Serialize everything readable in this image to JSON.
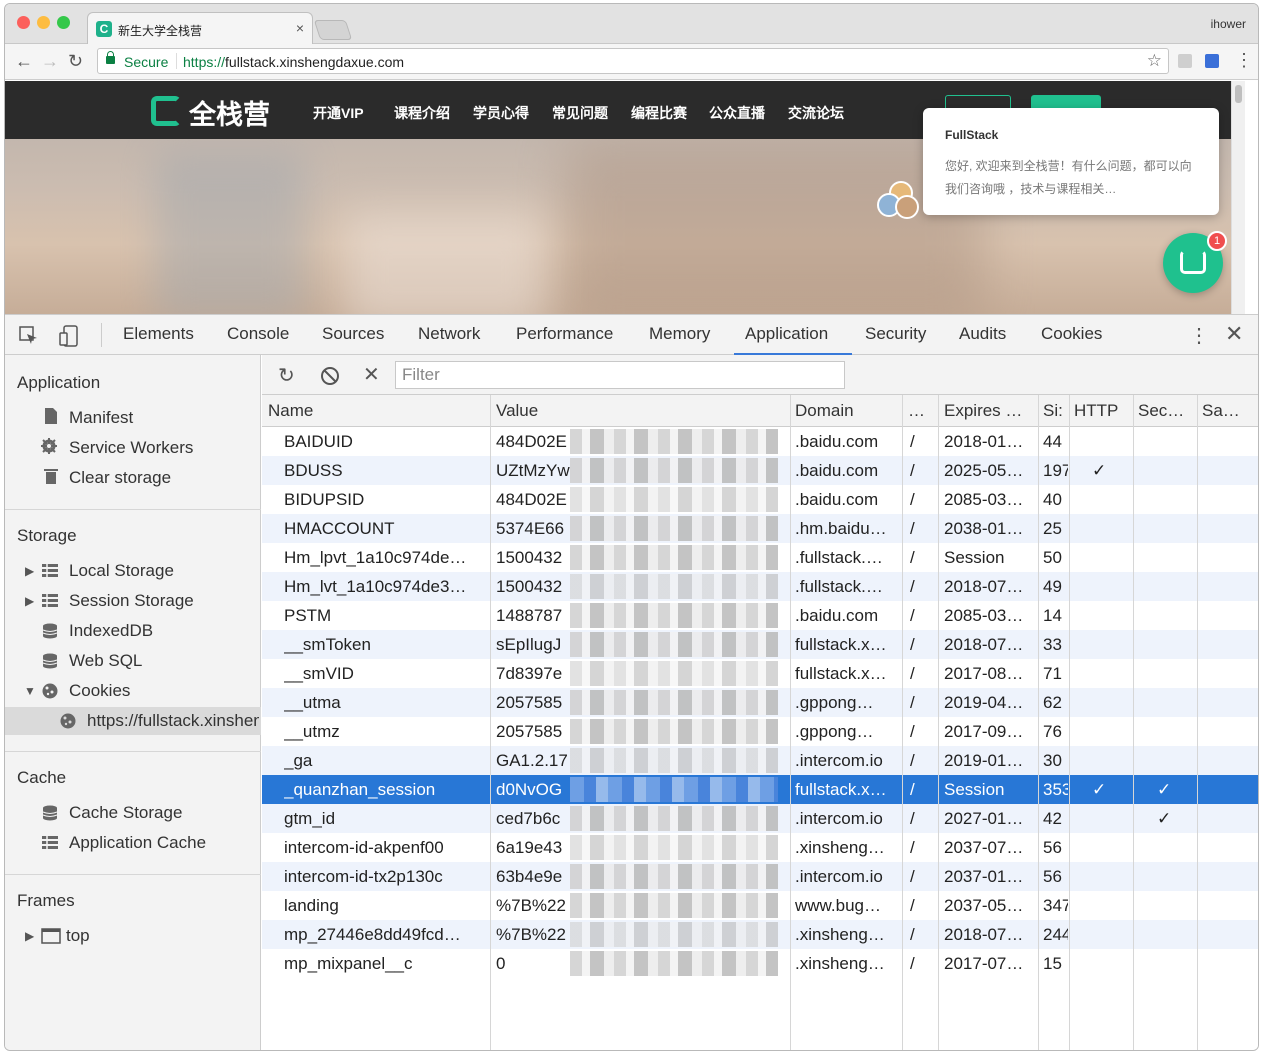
{
  "browser": {
    "tab_title": "新生大学全栈营",
    "tab_close": "×",
    "user_name": "ihower",
    "secure_label": "Secure",
    "url_scheme": "https://",
    "url_host": "fullstack.xinshengdaxue.com",
    "colors": {
      "secure": "#0b8043",
      "close": "#fc605c",
      "minimize": "#fdbc40",
      "maximize": "#34c84a"
    }
  },
  "site": {
    "logo_text": "全栈营",
    "nav": [
      "开通VIP",
      "课程介绍",
      "学员心得",
      "常见问题",
      "编程比赛",
      "公众直播",
      "交流论坛"
    ],
    "chat_popup": {
      "sender": "FullStack",
      "message": "您好, 欢迎来到全栈营！有什么问题，都可以向我们咨询哦 ，技术与课程相关…"
    },
    "chat_badge": "1",
    "accent": "#20c08f"
  },
  "devtools": {
    "tabs": [
      "Elements",
      "Console",
      "Sources",
      "Network",
      "Performance",
      "Memory",
      "Application",
      "Security",
      "Audits",
      "Cookies"
    ],
    "active_tab": "Application",
    "sidebar": {
      "application_header": "Application",
      "application_items": [
        "Manifest",
        "Service Workers",
        "Clear storage"
      ],
      "storage_header": "Storage",
      "storage_items": [
        "Local Storage",
        "Session Storage",
        "IndexedDB",
        "Web SQL",
        "Cookies"
      ],
      "cookie_origin": "https://fullstack.xinshengdaxue.com",
      "cache_header": "Cache",
      "cache_items": [
        "Cache Storage",
        "Application Cache"
      ],
      "frames_header": "Frames",
      "frames_items": [
        "top"
      ]
    },
    "filter_placeholder": "Filter",
    "columns": [
      "Name",
      "Value",
      "Domain",
      "…",
      "Expires …",
      "Si:",
      "HTTP",
      "Sec…",
      "Sa…"
    ],
    "rows": [
      {
        "name": "BAIDUID",
        "value": "484D02E",
        "domain": ".baidu.com",
        "path": "/",
        "expires": "2018-01…",
        "size": "44",
        "http": "",
        "secure": ""
      },
      {
        "name": "BDUSS",
        "value": "UZtMzYw",
        "domain": ".baidu.com",
        "path": "/",
        "expires": "2025-05…",
        "size": "197",
        "http": "✓",
        "secure": ""
      },
      {
        "name": "BIDUPSID",
        "value": "484D02E",
        "domain": ".baidu.com",
        "path": "/",
        "expires": "2085-03…",
        "size": "40",
        "http": "",
        "secure": ""
      },
      {
        "name": "HMACCOUNT",
        "value": "5374E66",
        "domain": ".hm.baidu…",
        "path": "/",
        "expires": "2038-01…",
        "size": "25",
        "http": "",
        "secure": ""
      },
      {
        "name": "Hm_lpvt_1a10c974de…",
        "value": "1500432",
        "domain": ".fullstack.…",
        "path": "/",
        "expires": "Session",
        "size": "50",
        "http": "",
        "secure": ""
      },
      {
        "name": "Hm_lvt_1a10c974de3…",
        "value": "1500432",
        "domain": ".fullstack.…",
        "path": "/",
        "expires": "2018-07…",
        "size": "49",
        "http": "",
        "secure": ""
      },
      {
        "name": "PSTM",
        "value": "1488787",
        "domain": ".baidu.com",
        "path": "/",
        "expires": "2085-03…",
        "size": "14",
        "http": "",
        "secure": ""
      },
      {
        "name": "__smToken",
        "value": "sEpIlugJ",
        "domain": "fullstack.x…",
        "path": "/",
        "expires": "2018-07…",
        "size": "33",
        "http": "",
        "secure": ""
      },
      {
        "name": "__smVID",
        "value": "7d8397e",
        "domain": "fullstack.x…",
        "path": "/",
        "expires": "2017-08…",
        "size": "71",
        "http": "",
        "secure": ""
      },
      {
        "name": "__utma",
        "value": "2057585",
        "domain": ".gppong…",
        "path": "/",
        "expires": "2019-04…",
        "size": "62",
        "http": "",
        "secure": ""
      },
      {
        "name": "__utmz",
        "value": "2057585",
        "domain": ".gppong…",
        "path": "/",
        "expires": "2017-09…",
        "size": "76",
        "http": "",
        "secure": ""
      },
      {
        "name": "_ga",
        "value": "GA1.2.17",
        "domain": ".intercom.io",
        "path": "/",
        "expires": "2019-01…",
        "size": "30",
        "http": "",
        "secure": ""
      },
      {
        "name": "_quanzhan_session",
        "value": "d0NvOG",
        "domain": "fullstack.x…",
        "path": "/",
        "expires": "Session",
        "size": "353",
        "http": "✓",
        "secure": "✓"
      },
      {
        "name": "gtm_id",
        "value": "ced7b6c",
        "domain": ".intercom.io",
        "path": "/",
        "expires": "2027-01…",
        "size": "42",
        "http": "",
        "secure": "✓"
      },
      {
        "name": "intercom-id-akpenf00",
        "value": "6a19e43",
        "domain": ".xinsheng…",
        "path": "/",
        "expires": "2037-07…",
        "size": "56",
        "http": "",
        "secure": ""
      },
      {
        "name": "intercom-id-tx2p130c",
        "value": "63b4e9e",
        "domain": ".intercom.io",
        "path": "/",
        "expires": "2037-01…",
        "size": "56",
        "http": "",
        "secure": ""
      },
      {
        "name": "landing",
        "value": "%7B%22",
        "domain": "www.bug…",
        "path": "/",
        "expires": "2037-05…",
        "size": "347",
        "http": "",
        "secure": ""
      },
      {
        "name": "mp_27446e8dd49fcd…",
        "value": "%7B%22",
        "domain": ".xinsheng…",
        "path": "/",
        "expires": "2018-07…",
        "size": "244",
        "http": "",
        "secure": ""
      },
      {
        "name": "mp_mixpanel__c",
        "value": "0",
        "domain": ".xinsheng…",
        "path": "/",
        "expires": "2017-07…",
        "size": "15",
        "http": "",
        "secure": ""
      }
    ],
    "selected_row": "_quanzhan_session"
  }
}
